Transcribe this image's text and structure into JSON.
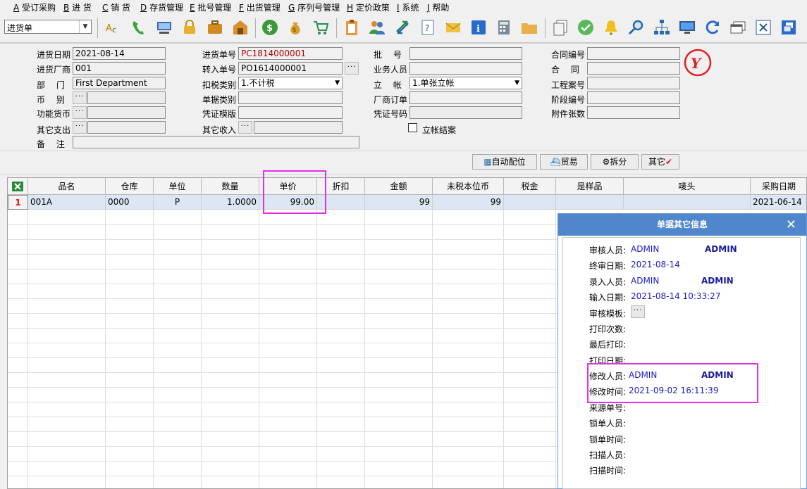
{
  "menu": [
    {
      "key": "A",
      "label": "受订采购"
    },
    {
      "key": "B",
      "label": "进 货"
    },
    {
      "key": "C",
      "label": "销 货"
    },
    {
      "key": "D",
      "label": "存货管理"
    },
    {
      "key": "E",
      "label": "批号管理"
    },
    {
      "key": "F",
      "label": "出货管理"
    },
    {
      "key": "G",
      "label": "序列号管理"
    },
    {
      "key": "H",
      "label": "定价政策"
    },
    {
      "key": "I",
      "label": "系统"
    },
    {
      "key": "J",
      "label": "帮助"
    }
  ],
  "toolbar": {
    "doc_type": "进货单"
  },
  "form": {
    "purchase_date_label": "进货日期",
    "purchase_date": "2021-08-14",
    "supplier_label": "进货厂商",
    "supplier": "001",
    "dept_label": "部　 门",
    "dept": "First Department",
    "currency_label": "币　 别",
    "func_currency_label": "功能货币",
    "other_expense_label": "其它支出",
    "remark_label": "备　 注",
    "purchase_no_label": "进货单号",
    "purchase_no": "PC1814000001",
    "transfer_no_label": "转入单号",
    "transfer_no": "PO1614000001",
    "tax_type_label": "扣税类别",
    "tax_type": "1.不计税",
    "doc_category_label": "单据类别",
    "voucher_template_label": "凭证模版",
    "other_income_label": "其它收入",
    "batch_no_label": "批　 号",
    "salesperson_label": "业务人员",
    "account_label": "立　 帐",
    "account": "1.单张立帐",
    "vendor_order_label": "厂商订单",
    "voucher_no_label": "凭证号码",
    "close_account_label": "立帐结案",
    "contract_no_label": "合同编号",
    "contract_label": "合　 同",
    "project_no_label": "工程案号",
    "stage_no_label": "阶段编号",
    "attachments_label": "附件张数",
    "stamp_text": "Y"
  },
  "buttons": {
    "auto_match": "自动配位",
    "trade": "贸易",
    "split": "拆分",
    "other": "其它"
  },
  "grid": {
    "columns": [
      "品名",
      "仓库",
      "单位",
      "数量",
      "单价",
      "折扣",
      "金额",
      "未税本位币",
      "税金",
      "是样品",
      "唛头",
      "采购日期"
    ],
    "rows": [
      {
        "index": "1",
        "item": "001A",
        "warehouse": "0000",
        "unit": "P",
        "qty": "1.0000",
        "price": "99.00",
        "discount": "",
        "amount": "99",
        "untaxed": "99",
        "tax": "",
        "sample": "",
        "mark": "",
        "purchase_date": "2021-06-14"
      }
    ]
  },
  "popup": {
    "title": "单据其它信息",
    "fields": [
      {
        "label": "审核人员:",
        "value": "ADMIN",
        "value2": "ADMIN"
      },
      {
        "label": "终审日期:",
        "value": "2021-08-14",
        "value2": ""
      },
      {
        "label": "录入人员:",
        "value": "ADMIN",
        "value2": "ADMIN"
      },
      {
        "label": "输入日期:",
        "value": "2021-08-14 10:33:27",
        "value2": ""
      },
      {
        "label": "审核模板:",
        "value": "",
        "value2": ""
      },
      {
        "label": "打印次数:",
        "value": "",
        "value2": ""
      },
      {
        "label": "最后打印:",
        "value": "",
        "value2": ""
      },
      {
        "label": "打印日期:",
        "value": "",
        "value2": ""
      },
      {
        "label": "修改人员:",
        "value": "ADMIN",
        "value2": "ADMIN"
      },
      {
        "label": "修改时间:",
        "value": "2021-09-02 16:11:39",
        "value2": ""
      },
      {
        "label": "来源单号:",
        "value": "",
        "value2": ""
      },
      {
        "label": "锁单人员:",
        "value": "",
        "value2": ""
      },
      {
        "label": "锁单时间:",
        "value": "",
        "value2": ""
      },
      {
        "label": "扫描人员:",
        "value": "",
        "value2": ""
      },
      {
        "label": "扫描时间:",
        "value": "",
        "value2": ""
      }
    ]
  },
  "colors": {
    "popup_title": "#4f86cc",
    "highlight": "#e62ee6",
    "value_blue": "#1a1ac8",
    "row_select": "#dde7f3"
  }
}
